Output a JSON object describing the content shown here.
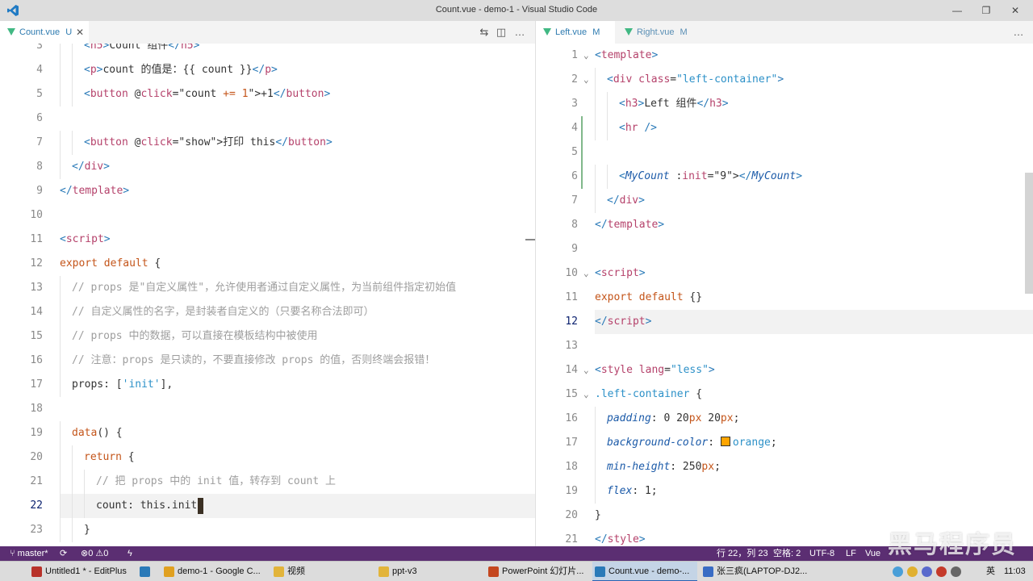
{
  "window": {
    "title": "Count.vue - demo-1 - Visual Studio Code",
    "minimize": "—",
    "maximize": "❐",
    "close": "✕"
  },
  "left_tabs": [
    {
      "name": "Count.vue",
      "status": "U"
    }
  ],
  "right_tabs": [
    {
      "name": "Left.vue",
      "status": "M"
    },
    {
      "name": "Right.vue",
      "status": "M"
    }
  ],
  "left_editor": {
    "current_line": "22",
    "lines": [
      {
        "n": "3",
        "indent": 2,
        "parts": [
          [
            "tg",
            "<"
          ],
          [
            "tn",
            "h5"
          ],
          [
            "tg",
            ">"
          ],
          [
            "",
            "Count 组件"
          ],
          [
            "tg",
            "</"
          ],
          [
            "tn",
            "h5"
          ],
          [
            "tg",
            ">"
          ]
        ]
      },
      {
        "n": "4",
        "indent": 2,
        "parts": [
          [
            "tg",
            "<"
          ],
          [
            "tn",
            "p"
          ],
          [
            "tg",
            ">"
          ],
          [
            "",
            "count 的值是：{{ count }}"
          ],
          [
            "tg",
            "</"
          ],
          [
            "tn",
            "p"
          ],
          [
            "tg",
            ">"
          ]
        ]
      },
      {
        "n": "5",
        "indent": 2,
        "parts": [
          [
            "tg",
            "<"
          ],
          [
            "tn",
            "button"
          ],
          [
            "",
            " @"
          ],
          [
            "at",
            "click"
          ],
          [
            "",
            "=\"count "
          ],
          [
            "op",
            "+="
          ],
          [
            "",
            " "
          ],
          [
            "nm",
            "1"
          ],
          [
            "",
            "\">+1"
          ],
          [
            "tg",
            "</"
          ],
          [
            "tn",
            "button"
          ],
          [
            "tg",
            ">"
          ]
        ]
      },
      {
        "n": "6",
        "indent": 0,
        "parts": []
      },
      {
        "n": "7",
        "indent": 2,
        "parts": [
          [
            "tg",
            "<"
          ],
          [
            "tn",
            "button"
          ],
          [
            "",
            " @"
          ],
          [
            "at",
            "click"
          ],
          [
            "",
            "=\"show\">打印 this"
          ],
          [
            "tg",
            "</"
          ],
          [
            "tn",
            "button"
          ],
          [
            "tg",
            ">"
          ]
        ]
      },
      {
        "n": "8",
        "indent": 1,
        "parts": [
          [
            "tg",
            "</"
          ],
          [
            "tn",
            "div"
          ],
          [
            "tg",
            ">"
          ]
        ]
      },
      {
        "n": "9",
        "indent": 0,
        "parts": [
          [
            "tg",
            "</"
          ],
          [
            "tn",
            "template"
          ],
          [
            "tg",
            ">"
          ]
        ]
      },
      {
        "n": "10",
        "indent": 0,
        "parts": []
      },
      {
        "n": "11",
        "indent": 0,
        "parts": [
          [
            "tg",
            "<"
          ],
          [
            "tn",
            "script"
          ],
          [
            "tg",
            ">"
          ]
        ]
      },
      {
        "n": "12",
        "indent": 0,
        "parts": [
          [
            "kw",
            "export default"
          ],
          [
            "",
            " {"
          ]
        ]
      },
      {
        "n": "13",
        "indent": 1,
        "parts": [
          [
            "cm",
            "// props 是\"自定义属性\"，允许使用者通过自定义属性，为当前组件指定初始值"
          ]
        ]
      },
      {
        "n": "14",
        "indent": 1,
        "parts": [
          [
            "cm",
            "// 自定义属性的名字，是封装者自定义的（只要名称合法即可）"
          ]
        ]
      },
      {
        "n": "15",
        "indent": 1,
        "parts": [
          [
            "cm",
            "// props 中的数据，可以直接在模板结构中被使用"
          ]
        ]
      },
      {
        "n": "16",
        "indent": 1,
        "parts": [
          [
            "cm",
            "// 注意：props 是只读的，不要直接修改 props 的值，否则终端会报错！"
          ]
        ]
      },
      {
        "n": "17",
        "indent": 1,
        "parts": [
          [
            "",
            "props: ["
          ],
          [
            "st",
            "'init'"
          ],
          [
            "",
            "],"
          ]
        ]
      },
      {
        "n": "18",
        "indent": 0,
        "parts": []
      },
      {
        "n": "19",
        "indent": 1,
        "parts": [
          [
            "kw",
            "data"
          ],
          [
            "",
            "() {"
          ]
        ]
      },
      {
        "n": "20",
        "indent": 2,
        "parts": [
          [
            "kw",
            "return"
          ],
          [
            "",
            " {"
          ]
        ]
      },
      {
        "n": "21",
        "indent": 3,
        "parts": [
          [
            "cm",
            "// 把 props 中的 init 值，转存到 count 上"
          ]
        ]
      },
      {
        "n": "22",
        "indent": 3,
        "parts": [
          [
            "",
            "count: this.init"
          ]
        ]
      },
      {
        "n": "23",
        "indent": 2,
        "parts": [
          [
            "",
            "}"
          ]
        ]
      }
    ]
  },
  "right_editor": {
    "current_line": "12",
    "lines": [
      {
        "n": "1",
        "indent": 0,
        "fold": true,
        "parts": [
          [
            "tg",
            "<"
          ],
          [
            "tn",
            "template"
          ],
          [
            "tg",
            ">"
          ]
        ]
      },
      {
        "n": "2",
        "indent": 1,
        "fold": true,
        "parts": [
          [
            "tg",
            "<"
          ],
          [
            "tn",
            "div"
          ],
          [
            "",
            " "
          ],
          [
            "at",
            "class"
          ],
          [
            "",
            "="
          ],
          [
            "st",
            "\"left-container\""
          ],
          [
            "tg",
            ">"
          ]
        ]
      },
      {
        "n": "3",
        "indent": 2,
        "parts": [
          [
            "tg",
            "<"
          ],
          [
            "tn",
            "h3"
          ],
          [
            "tg",
            ">"
          ],
          [
            "",
            "Left 组件"
          ],
          [
            "tg",
            "</"
          ],
          [
            "tn",
            "h3"
          ],
          [
            "tg",
            ">"
          ]
        ]
      },
      {
        "n": "4",
        "indent": 2,
        "parts": [
          [
            "tg",
            "<"
          ],
          [
            "tn",
            "hr"
          ],
          [
            "",
            " "
          ],
          [
            "tg",
            "/>"
          ]
        ]
      },
      {
        "n": "5",
        "indent": 0,
        "parts": []
      },
      {
        "n": "6",
        "indent": 2,
        "parts": [
          [
            "tg",
            "<"
          ],
          [
            "cmp",
            "MyCount"
          ],
          [
            "",
            " :"
          ],
          [
            "at",
            "init"
          ],
          [
            "",
            "=\"9\">"
          ],
          [
            "tg",
            "</"
          ],
          [
            "cmp",
            "MyCount"
          ],
          [
            "tg",
            ">"
          ]
        ]
      },
      {
        "n": "7",
        "indent": 1,
        "parts": [
          [
            "tg",
            "</"
          ],
          [
            "tn",
            "div"
          ],
          [
            "tg",
            ">"
          ]
        ]
      },
      {
        "n": "8",
        "indent": 0,
        "parts": [
          [
            "tg",
            "</"
          ],
          [
            "tn",
            "template"
          ],
          [
            "tg",
            ">"
          ]
        ]
      },
      {
        "n": "9",
        "indent": 0,
        "parts": []
      },
      {
        "n": "10",
        "indent": 0,
        "fold": true,
        "parts": [
          [
            "tg",
            "<"
          ],
          [
            "tn",
            "script"
          ],
          [
            "tg",
            ">"
          ]
        ]
      },
      {
        "n": "11",
        "indent": 0,
        "parts": [
          [
            "kw",
            "export default"
          ],
          [
            "",
            " {}"
          ]
        ]
      },
      {
        "n": "12",
        "indent": 0,
        "parts": [
          [
            "tg",
            "</"
          ],
          [
            "tn",
            "script"
          ],
          [
            "tg",
            ">"
          ]
        ]
      },
      {
        "n": "13",
        "indent": 0,
        "parts": []
      },
      {
        "n": "14",
        "indent": 0,
        "fold": true,
        "parts": [
          [
            "tg",
            "<"
          ],
          [
            "tn",
            "style"
          ],
          [
            "",
            " "
          ],
          [
            "at",
            "lang"
          ],
          [
            "",
            "="
          ],
          [
            "st",
            "\"less\""
          ],
          [
            "tg",
            ">"
          ]
        ]
      },
      {
        "n": "15",
        "indent": 0,
        "fold": true,
        "parts": [
          [
            "st",
            ".left-container"
          ],
          [
            "",
            " {"
          ]
        ]
      },
      {
        "n": "16",
        "indent": 1,
        "parts": [
          [
            "pr",
            "padding"
          ],
          [
            "",
            ": 0 20"
          ],
          [
            "nm",
            "px"
          ],
          [
            "",
            " 20"
          ],
          [
            "nm",
            "px"
          ],
          [
            "",
            ";"
          ]
        ]
      },
      {
        "n": "17",
        "indent": 1,
        "swatch": true,
        "parts": [
          [
            "pr",
            "background-color"
          ],
          [
            "",
            ": "
          ],
          [
            "swatch",
            ""
          ],
          [
            "st",
            "orange"
          ],
          [
            "",
            ";"
          ]
        ]
      },
      {
        "n": "18",
        "indent": 1,
        "parts": [
          [
            "pr",
            "min-height"
          ],
          [
            "",
            ": 250"
          ],
          [
            "nm",
            "px"
          ],
          [
            "",
            ";"
          ]
        ]
      },
      {
        "n": "19",
        "indent": 1,
        "parts": [
          [
            "pr",
            "flex"
          ],
          [
            "",
            ": 1;"
          ]
        ]
      },
      {
        "n": "20",
        "indent": 0,
        "parts": [
          [
            "",
            "}"
          ]
        ]
      },
      {
        "n": "21",
        "indent": 0,
        "parts": [
          [
            "tg",
            "</"
          ],
          [
            "tn",
            "style"
          ],
          [
            "tg",
            ">"
          ]
        ]
      }
    ]
  },
  "statusbar": {
    "branch": "master*",
    "errors": "0",
    "warnings": "0",
    "position": "行 22，列 23",
    "spaces": "空格: 2",
    "encoding": "UTF-8",
    "eol": "LF",
    "language": "Vue",
    "watermark": "黑马程序员"
  },
  "taskbar": {
    "items": [
      {
        "label": "Untitled1 * - EditPlus",
        "color": "#b8322a"
      },
      {
        "label": "",
        "color": "#2a7ab8"
      },
      {
        "label": "demo-1 - Google C...",
        "color": "#e0a020"
      },
      {
        "label": "视频",
        "color": "#e2b43a"
      },
      {
        "label": "ppt-v3",
        "color": "#e2b43a"
      },
      {
        "label": "PowerPoint 幻灯片...",
        "color": "#c4471f"
      },
      {
        "label": "Count.vue - demo-...",
        "color": "#2a7ab8"
      },
      {
        "label": "张三疯(LAPTOP-DJ2...",
        "color": "#3a6cc4"
      }
    ],
    "ime": "英",
    "time": "11:03"
  }
}
